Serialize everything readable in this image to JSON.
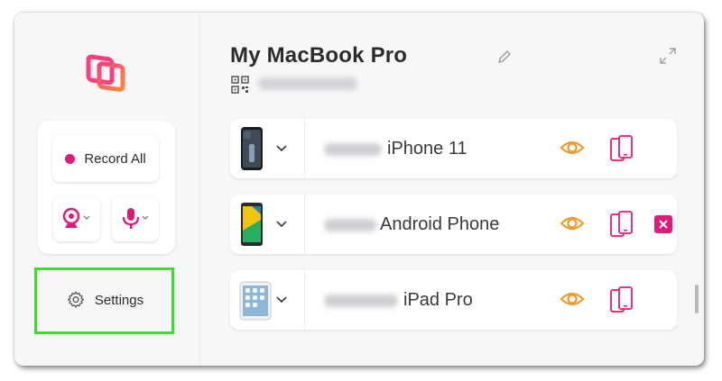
{
  "sidebar": {
    "record_all_label": "Record All",
    "settings_label": "Settings"
  },
  "main": {
    "title": "My MacBook Pro",
    "devices": [
      {
        "name": "iPhone 11",
        "icon": "iphone-thumbnail"
      },
      {
        "name": "Android Phone",
        "icon": "android-thumbnail"
      },
      {
        "name": "iPad Pro",
        "icon": "ipad-thumbnail"
      }
    ]
  },
  "colors": {
    "accent_pink": "#e0197d",
    "accent_orange": "#f29a2e",
    "highlight_green": "#3fdc2f"
  }
}
